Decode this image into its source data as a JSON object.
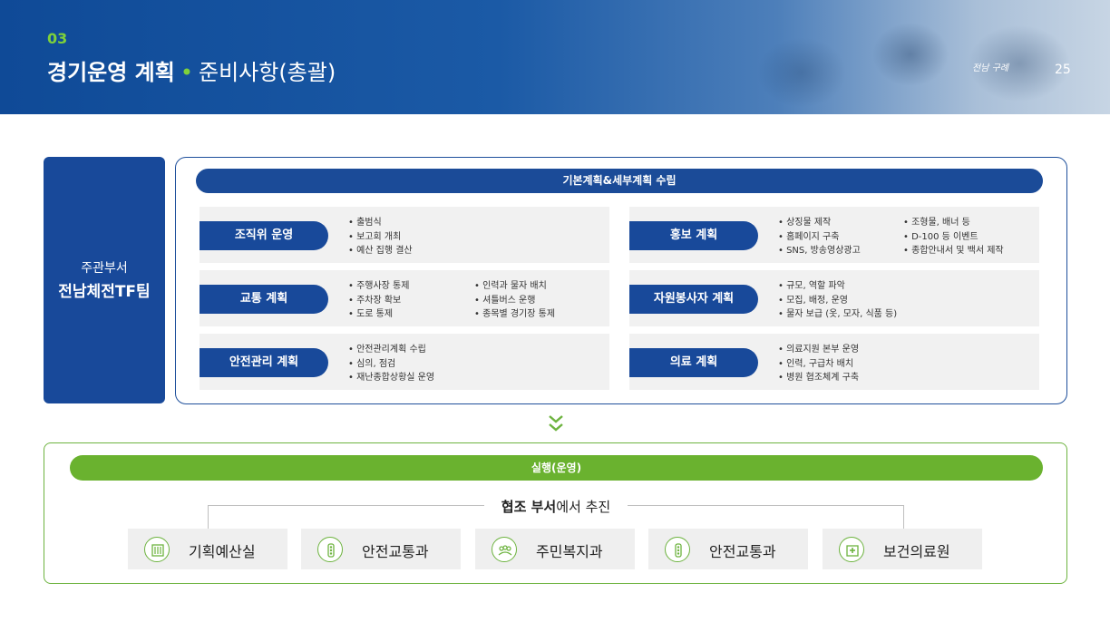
{
  "header": {
    "section_number": "03",
    "title_bold": "경기운영 계획",
    "title_dot": "•",
    "title_rest": "준비사항(총괄)",
    "logo_text": "전남 구례",
    "page_number": "25"
  },
  "responsible": {
    "subtitle": "주관부서",
    "name": "전남체전TF팀"
  },
  "plan": {
    "header": "기본계획&세부계획 수립",
    "items": [
      {
        "label": "조직위 운영",
        "col1": [
          "출범식",
          "보고회 개최",
          "예산 집행 결산"
        ],
        "col2": []
      },
      {
        "label": "홍보 계획",
        "col1": [
          "상징물 제작",
          "홈페이지 구축",
          "SNS, 방송영상광고"
        ],
        "col2": [
          "조형물, 배너 등",
          "D-100 등 이벤트",
          "종합안내서 및 백서 제작"
        ]
      },
      {
        "label": "교통 계획",
        "col1": [
          "주행사장 통제",
          "주차장 확보",
          "도로 통제"
        ],
        "col2": [
          "인력과 물자 배치",
          "셔틀버스 운행",
          "종목별 경기장 통제"
        ]
      },
      {
        "label": "자원봉사자 계획",
        "col1": [
          "규모, 역할 파악",
          "모집, 배정, 운영",
          "물자 보급 (옷, 모자, 식품 등)"
        ],
        "col2": []
      },
      {
        "label": "안전관리 계획",
        "col1": [
          "안전관리계획 수립",
          "심의, 점검",
          "재난종합상황실 운영"
        ],
        "col2": []
      },
      {
        "label": "의료 계획",
        "col1": [
          "의료지원 본부 운영",
          "인력, 구급차 배치",
          "병원 협조체계 구축"
        ],
        "col2": []
      }
    ]
  },
  "execution": {
    "header": "실행(운영)",
    "coop_bold": "협조 부서",
    "coop_rest": "에서 추진",
    "departments": [
      {
        "name": "기획예산실",
        "icon": "building-icon"
      },
      {
        "name": "안전교통과",
        "icon": "traffic-light-icon"
      },
      {
        "name": "주민복지과",
        "icon": "people-icon"
      },
      {
        "name": "안전교통과",
        "icon": "traffic-light-icon"
      },
      {
        "name": "보건의료원",
        "icon": "hospital-icon"
      }
    ]
  },
  "colors": {
    "navy": "#18499a",
    "green": "#6ab22f",
    "accent_green": "#7ed13a"
  }
}
